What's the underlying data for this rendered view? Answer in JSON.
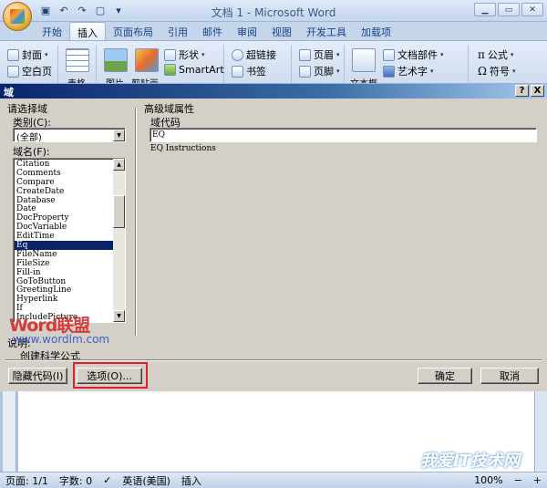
{
  "window": {
    "title": "文档 1 - Microsoft Word"
  },
  "ribbon_tabs": [
    "开始",
    "插入",
    "页面布局",
    "引用",
    "邮件",
    "审阅",
    "视图",
    "开发工具",
    "加载项"
  ],
  "active_tab": "插入",
  "ribbon": {
    "cover_page": "封面",
    "blank_page": "空白页",
    "table": "表格",
    "picture": "图片",
    "clip_art": "剪贴画",
    "shapes": "形状",
    "smartart": "SmartArt",
    "hyperlink": "超链接",
    "bookmark": "书签",
    "header": "页眉",
    "footer": "页脚",
    "text_box": "文本框",
    "quick_parts": "文档部件",
    "wordart": "艺术字",
    "equation": "公式",
    "symbol": "符号"
  },
  "dialog": {
    "title": "域",
    "help_button": "?",
    "close_button": "X",
    "choose_field_label": "请选择域",
    "category_label": "类别(C):",
    "category_value": "(全部)",
    "field_names_label": "域名(F):",
    "field_names": [
      "Citation",
      "Comments",
      "Compare",
      "CreateDate",
      "Database",
      "Date",
      "DocProperty",
      "DocVariable",
      "EditTime",
      "Eq",
      "FileName",
      "FileSize",
      "Fill-in",
      "GoToButton",
      "GreetingLine",
      "Hyperlink",
      "If",
      "IncludePicture"
    ],
    "selected_field": "Eq",
    "advanced_label": "高级域属性",
    "field_codes_label": "域代码",
    "field_code_value": "EQ",
    "field_instructions": "EQ Instructions",
    "description_label": "说明:",
    "description_text": "创建科学公式",
    "hide_codes_button": "隐藏代码(I)",
    "options_button": "选项(O)...",
    "ok_button": "确定",
    "cancel_button": "取消"
  },
  "watermark": {
    "word_text": "Word联盟",
    "url_text": "www.wordlm.com",
    "corner_text": "我爱IT技术网"
  },
  "statusbar": {
    "page": "页面: 1/1",
    "word_count": "字数: 0",
    "language": "英语(美国)",
    "insert_mode": "插入",
    "zoom": "100%"
  },
  "colors": {
    "selection": "#0a246a",
    "highlight_box": "#e0202a",
    "ribbon_bg": "#d6e3f3"
  }
}
